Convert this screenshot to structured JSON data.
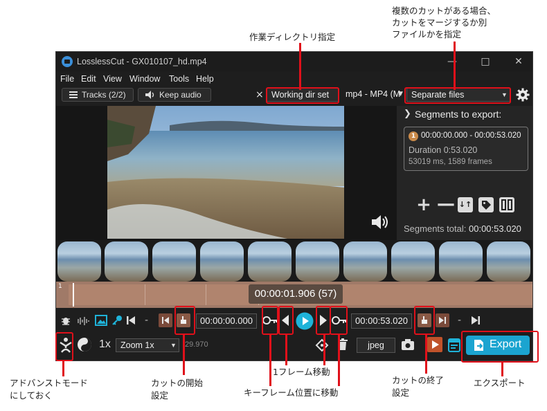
{
  "annotations": {
    "workdir": "作業ディレクトリ指定",
    "multi_line1": "複数のカットがある場合、",
    "multi_line2": "カットをマージするか別",
    "multi_line3": "ファイルかを指定",
    "advanced_line1": "アドバンストモード",
    "advanced_line2": "にしておく",
    "cut_start_line1": "カットの開始",
    "cut_start_line2": "設定",
    "frame_move": "1フレーム移動",
    "keyframe_move": "キーフレーム位置に移動",
    "cut_end_line1": "カットの終了",
    "cut_end_line2": "設定",
    "export": "エクスポート",
    "highlight_color": "#e0101a"
  },
  "window": {
    "title": "LosslessCut - GX010107_hd.mp4",
    "minimize_icon": "minimize-icon",
    "maximize_icon": "maximize-icon",
    "close_icon": "close-icon"
  },
  "menu": [
    "File",
    "Edit",
    "View",
    "Window",
    "Tools",
    "Help"
  ],
  "toolbar": {
    "tracks_label": "Tracks (2/2)",
    "keep_audio_label": "Keep audio",
    "clear_icon": "×",
    "working_dir_label": "Working dir set",
    "format_label": "mp4 - MP4 (M",
    "output_mode_label": "Separate files",
    "settings_icon": "gear-icon"
  },
  "sidebar": {
    "heading": "Segments to export:",
    "segment_number": "1",
    "segment_range": "00:00:00.000 - 00:00:53.020",
    "segment_duration": "Duration 0:53.020",
    "segment_frames": "53019 ms, 1589 frames",
    "segments_total_label": "Segments total:",
    "segments_total_value": "00:00:53.020"
  },
  "timeline": {
    "start_marker": "1",
    "current_time": "00:00:01.906 (57)",
    "accent_color": "#b0846e"
  },
  "controls": {
    "dash1": "-",
    "dash2": "-",
    "cut_start_time": "00:00:00.000",
    "cut_end_time": "00:00:53.020",
    "play_color": "#1fb3d9"
  },
  "bottom": {
    "speed_label": "1x",
    "zoom_label": "Zoom 1x",
    "fps_label": "29.970",
    "snapshot_format": "jpeg",
    "export_label": "Export",
    "export_color": "#1ba4d0"
  }
}
